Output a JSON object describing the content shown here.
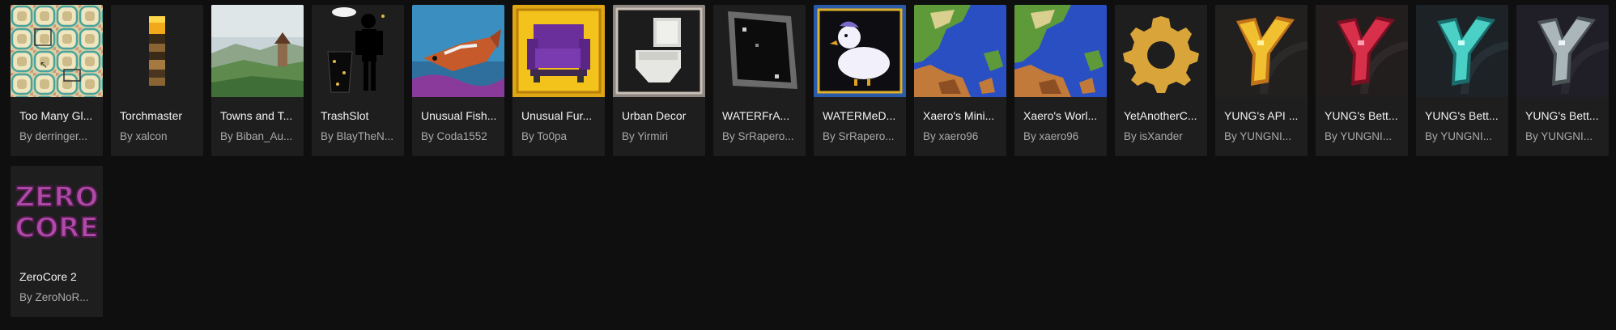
{
  "mods": [
    {
      "name": "Too Many Gl...",
      "author": "By derringer...",
      "icon": "glass-pattern-icon"
    },
    {
      "name": "Torchmaster",
      "author": "By xalcon",
      "icon": "torch-icon"
    },
    {
      "name": "Towns and T...",
      "author": "By Biban_Au...",
      "icon": "landscape-icon"
    },
    {
      "name": "TrashSlot",
      "author": "By BlayTheN...",
      "icon": "trash-figure-icon"
    },
    {
      "name": "Unusual Fish...",
      "author": "By Coda1552",
      "icon": "fish-icon"
    },
    {
      "name": "Unusual Fur...",
      "author": "By To0pa",
      "icon": "armchair-icon"
    },
    {
      "name": "Urban Decor",
      "author": "By Yirmiri",
      "icon": "toilet-icon"
    },
    {
      "name": "WATERFrA...",
      "author": "By SrRapero...",
      "icon": "frame-icon"
    },
    {
      "name": "WATERMeD...",
      "author": "By SrRapero...",
      "icon": "duck-icon"
    },
    {
      "name": "Xaero's Mini...",
      "author": "By xaero96",
      "icon": "map-icon"
    },
    {
      "name": "Xaero's Worl...",
      "author": "By xaero96",
      "icon": "map-icon"
    },
    {
      "name": "YetAnotherC...",
      "author": "By isXander",
      "icon": "gear-icon"
    },
    {
      "name": "YUNG's API ...",
      "author": "By YUNGNI...",
      "icon": "yung-gold-icon"
    },
    {
      "name": "YUNG's Bett...",
      "author": "By YUNGNI...",
      "icon": "yung-red-icon"
    },
    {
      "name": "YUNG's Bett...",
      "author": "By YUNGNI...",
      "icon": "yung-teal-icon"
    },
    {
      "name": "YUNG's Bett...",
      "author": "By YUNGNI...",
      "icon": "yung-silver-icon"
    },
    {
      "name": "ZeroCore 2",
      "author": "By ZeroNoR...",
      "icon": "zerocore-logo-icon",
      "logo_text": [
        "ZERO",
        "CORE"
      ]
    }
  ],
  "colors": {
    "page_background": "#0f0f0f",
    "card_background": "#1e1e1e",
    "title_text": "#f2f2f2",
    "author_text": "#a9a9a9"
  }
}
